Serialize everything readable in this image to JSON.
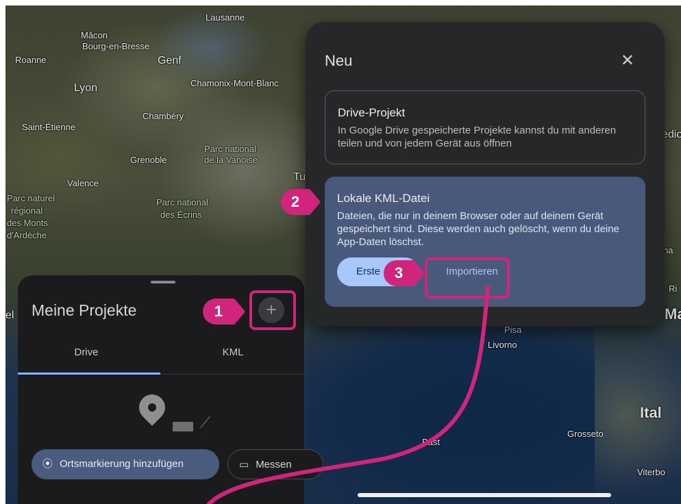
{
  "map": {
    "labels": [
      "Lausanne",
      "Mâcon",
      "Bourg-en-Bresse",
      "Roanne",
      "Genf",
      "Lyon",
      "Chamonix-Mont-Blanc",
      "Chambéry",
      "Saint-Étienne",
      "Parc national",
      "de la Vanoise",
      "Grenoble",
      "Tur",
      "Valence",
      "Parc naturel",
      "régional",
      "des Monts",
      "d'Ardèche",
      "Parc national",
      "des Écrins",
      "Pisa",
      "Livorno",
      "Ital",
      "Grosseto",
      "Bast",
      "Viterbo",
      "edio",
      "na",
      "Ri",
      "el",
      "Ma"
    ]
  },
  "panel": {
    "title": "Meine Projekte",
    "add_button": "+",
    "tabs": [
      "Drive",
      "KML"
    ],
    "chips": {
      "place": "Ortsmarkierung hinzufügen",
      "measure": "Messen"
    }
  },
  "dialog": {
    "title": "Neu",
    "close": "✕",
    "drive_card": {
      "title": "Drive-Projekt",
      "desc": "In Google Drive gespeicherte Projekte kannst du mit anderen teilen und von jedem Gerät aus öffnen"
    },
    "kml_card": {
      "title": "Lokale KML-Datei",
      "desc": "Dateien, die nur in deinem Browser oder auf deinem Gerät gespeichert sind. Diese werden auch gelöscht, wenn du deine App-Daten löschst.",
      "create_label": "Erste",
      "import_label": "Importieren"
    }
  },
  "annotations": [
    "1",
    "2",
    "3"
  ],
  "colors": {
    "accent": "#d1257c",
    "button_primary": "#a8c7fa",
    "card_highlight": "#48597b"
  }
}
